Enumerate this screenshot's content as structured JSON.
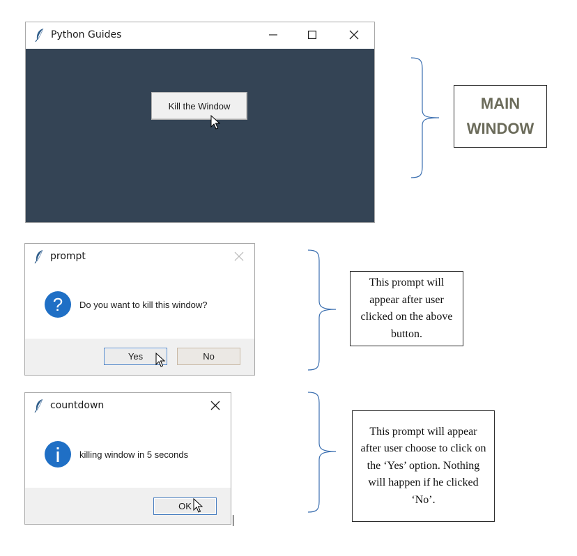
{
  "main_window": {
    "title": "Python Guides",
    "button_label": "Kill the Window",
    "body_color": "#344455"
  },
  "annotations": {
    "main_window_label_line1": "MAIN",
    "main_window_label_line2": "WINDOW",
    "prompt_note": "This prompt will appear after user clicked on the above button.",
    "countdown_note": "This prompt will appear after user choose to click on the ‘Yes’ option. Nothing will happen if he clicked ‘No’."
  },
  "prompt_dialog": {
    "title": "prompt",
    "message": "Do you want to kill this window?",
    "icon": "question-icon",
    "yes_label": "Yes",
    "no_label": "No"
  },
  "countdown_dialog": {
    "title": "countdown",
    "message": "killing window in 5 seconds",
    "icon": "info-icon",
    "ok_label": "OK"
  },
  "colors": {
    "accent_blue": "#1f6fc5",
    "brace_blue": "#3b6fb0",
    "label_gray": "#6b6b5a"
  }
}
